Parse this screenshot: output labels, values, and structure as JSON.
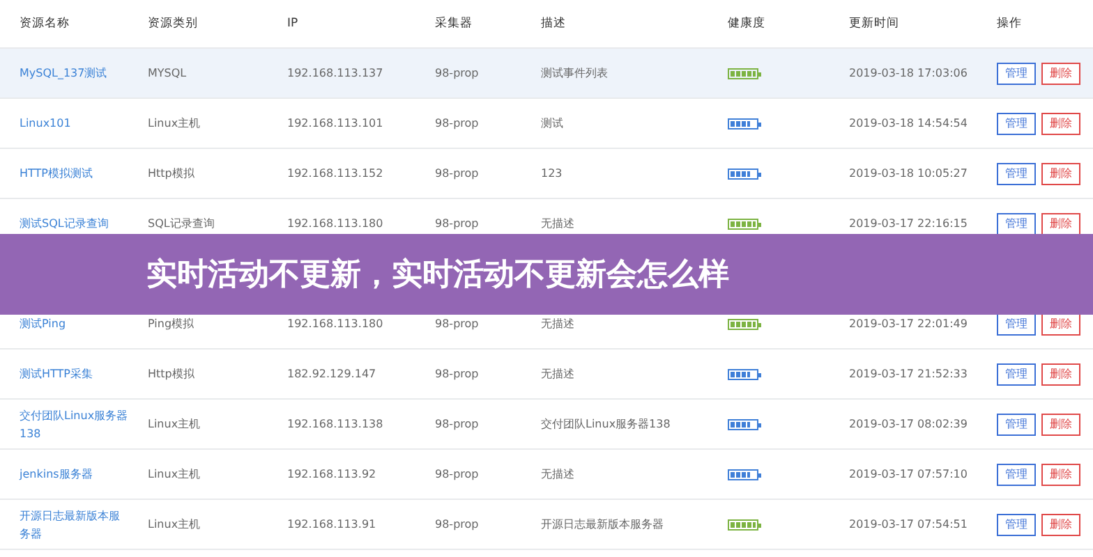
{
  "table": {
    "columns": [
      "资源名称",
      "资源类别",
      "IP",
      "采集器",
      "描述",
      "健康度",
      "更新时间",
      "操作"
    ],
    "rows": [
      {
        "name": "MySQL_137测试",
        "type": "MYSQL",
        "ip": "192.168.113.137",
        "collector": "98-prop",
        "description": "测试事件列表",
        "health": {
          "level": 1,
          "color": "#7cb342"
        },
        "updated": "2019-03-18 17:03:06",
        "highlighted": true,
        "actions": [
          "管理",
          "删除"
        ]
      },
      {
        "name": "Linux101",
        "type": "Linux主机",
        "ip": "192.168.113.101",
        "collector": "98-prop",
        "description": "测试",
        "health": {
          "level": 0.8,
          "color": "#3f7fd8"
        },
        "updated": "2019-03-18 14:54:54",
        "highlighted": false,
        "actions": [
          "管理",
          "删除"
        ]
      },
      {
        "name": "HTTP模拟测试",
        "type": "Http模拟",
        "ip": "192.168.113.152",
        "collector": "98-prop",
        "description": "123",
        "health": {
          "level": 0.8,
          "color": "#3f7fd8"
        },
        "updated": "2019-03-18 10:05:27",
        "highlighted": false,
        "actions": [
          "管理",
          "删除"
        ]
      },
      {
        "name": "测试SQL记录查询",
        "type": "SQL记录查询",
        "ip": "192.168.113.180",
        "collector": "98-prop",
        "description": "无描述",
        "health": {
          "level": 1,
          "color": "#7cb342"
        },
        "updated": "2019-03-17 22:16:15",
        "highlighted": false,
        "actions": [
          "管理",
          "删除"
        ]
      },
      {
        "name": "测试Ping",
        "type": "Ping模拟",
        "ip": "192.168.113.180",
        "collector": "98-prop",
        "description": "无描述",
        "health": {
          "level": 1,
          "color": "#7cb342"
        },
        "updated": "2019-03-17 22:01:49",
        "highlighted": false,
        "actions": [
          "管理",
          "删除"
        ]
      },
      {
        "name": "测试HTTP采集",
        "type": "Http模拟",
        "ip": "182.92.129.147",
        "collector": "98-prop",
        "description": "无描述",
        "health": {
          "level": 0.8,
          "color": "#3f7fd8"
        },
        "updated": "2019-03-17 21:52:33",
        "highlighted": false,
        "actions": [
          "管理",
          "删除"
        ]
      },
      {
        "name": "交付团队Linux服务器138",
        "type": "Linux主机",
        "ip": "192.168.113.138",
        "collector": "98-prop",
        "description": "交付团队Linux服务器138",
        "health": {
          "level": 0.8,
          "color": "#3f7fd8"
        },
        "updated": "2019-03-17 08:02:39",
        "highlighted": false,
        "actions": [
          "管理",
          "删除"
        ]
      },
      {
        "name": "jenkins服务器",
        "type": "Linux主机",
        "ip": "192.168.113.92",
        "collector": "98-prop",
        "description": "无描述",
        "health": {
          "level": 0.8,
          "color": "#3f7fd8"
        },
        "updated": "2019-03-17 07:57:10",
        "highlighted": false,
        "actions": [
          "管理",
          "删除"
        ]
      },
      {
        "name": "开源日志最新版本服务器",
        "type": "Linux主机",
        "ip": "192.168.113.91",
        "collector": "98-prop",
        "description": "开源日志最新版本服务器",
        "health": {
          "level": 1,
          "color": "#7cb342"
        },
        "updated": "2019-03-17 07:54:51",
        "highlighted": false,
        "actions": [
          "管理",
          "删除"
        ]
      }
    ]
  },
  "banner": {
    "text": "实时活动不更新，实时活动不更新会怎么样"
  }
}
